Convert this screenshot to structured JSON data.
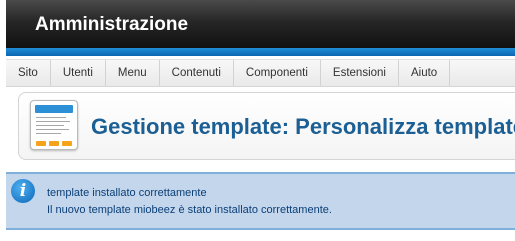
{
  "header": {
    "title": "Amministrazione"
  },
  "menu": {
    "items": [
      {
        "label": "Sito"
      },
      {
        "label": "Utenti"
      },
      {
        "label": "Menu"
      },
      {
        "label": "Contenuti"
      },
      {
        "label": "Componenti"
      },
      {
        "label": "Estensioni"
      },
      {
        "label": "Aiuto"
      }
    ]
  },
  "page": {
    "title": "Gestione template: Personalizza template"
  },
  "message": {
    "icon": "info-icon",
    "title": "template installato correttamente",
    "text": "Il nuovo template miobeez è stato installato correttamente."
  },
  "colors": {
    "header_bg": "#1a1a1a",
    "accent_blue": "#0b67b0",
    "title_blue": "#1b5f94",
    "notice_bg": "#c3d6ec"
  }
}
